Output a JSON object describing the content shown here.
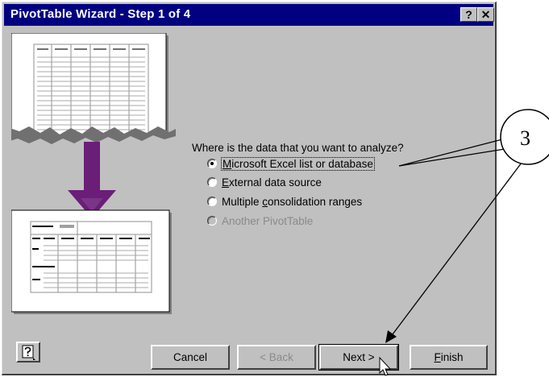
{
  "window": {
    "title": "PivotTable Wizard - Step 1 of 4",
    "help_glyph": "?",
    "close_glyph": "✕"
  },
  "prompt": {
    "question": "Where is the data that you want to analyze?"
  },
  "options": [
    {
      "pre": "",
      "key": "M",
      "post": "icrosoft Excel list or database",
      "checked": true,
      "enabled": true
    },
    {
      "pre": "",
      "key": "E",
      "post": "xternal data source",
      "checked": false,
      "enabled": true
    },
    {
      "pre": "Multiple ",
      "key": "c",
      "post": "onsolidation ranges",
      "checked": false,
      "enabled": true
    },
    {
      "pre": "",
      "key": "",
      "post": "Another PivotTable",
      "checked": false,
      "enabled": false
    }
  ],
  "buttons": {
    "cancel": "Cancel",
    "back": "< Back",
    "next": "Next >",
    "finish_key": "F",
    "finish_rest": "inish"
  },
  "annotation": {
    "callout_number": "3"
  },
  "icons": {
    "help": "office-assistant-icon",
    "illustration": "pivot-table-illustration",
    "cursor": "mouse-pointer-icon"
  },
  "colors": {
    "titlebar": "#000080",
    "dialog": "#c0c0c0",
    "arrow": "#6a1e78"
  }
}
